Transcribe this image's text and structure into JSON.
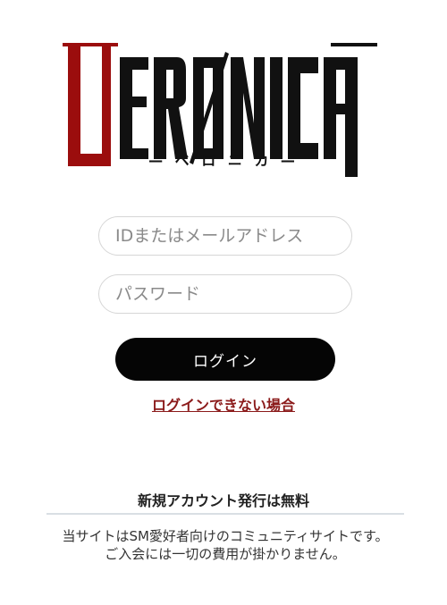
{
  "logo": {
    "wordmark": "VERØNICA",
    "subtitle": "— ベ ロ ニ カ —",
    "colors": {
      "accent": "#9b0d0d",
      "ink": "#111111"
    }
  },
  "form": {
    "id_placeholder": "IDまたはメールアドレス",
    "password_placeholder": "パスワード",
    "login_label": "ログイン",
    "trouble_link": "ログインできない場合"
  },
  "signup": {
    "title": "新規アカウント発行は無料",
    "line1": "当サイトはSM愛好者向けのコミュニティサイトです。",
    "line2": "ご入会には一切の費用が掛かりません。"
  }
}
